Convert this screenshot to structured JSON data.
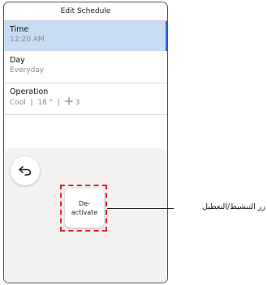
{
  "header": {
    "title": "Edit Schedule"
  },
  "rows": {
    "time": {
      "label": "Time",
      "value": "12:20 AM"
    },
    "day": {
      "label": "Day",
      "value": "Everyday"
    },
    "operation": {
      "label": "Operation",
      "mode": "Cool",
      "temperature": "18 °",
      "fan_level": "3",
      "fan_icon": "fan-icon"
    }
  },
  "buttons": {
    "back_icon": "back-arrow-icon",
    "deactivate_label": "De-\nactivate"
  },
  "annotation": {
    "callout_label": "زر التنشيط/التعطيل"
  },
  "colors": {
    "selected_row_bg": "#c8dcf4",
    "selected_row_border": "#2f6fd6",
    "highlight_dashed": "#e0202a",
    "panel_bg": "#f3f2f0"
  }
}
